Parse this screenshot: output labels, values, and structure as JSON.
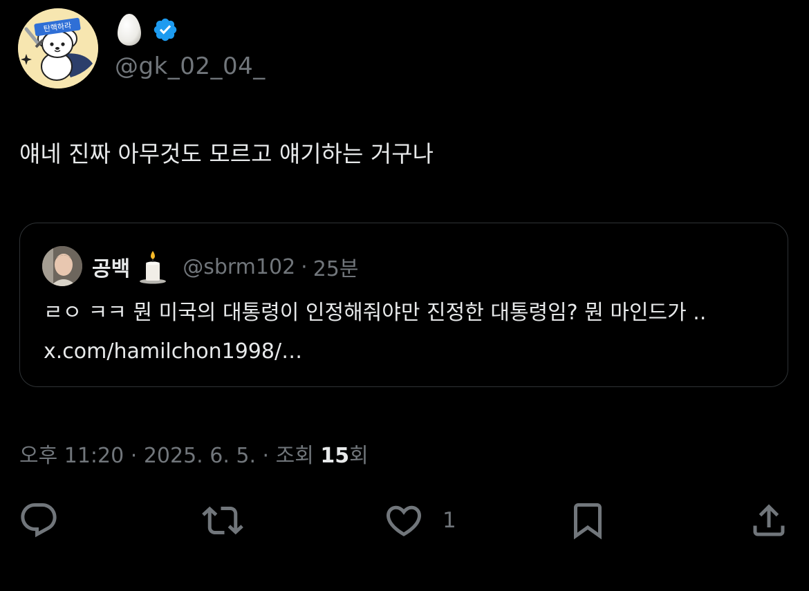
{
  "author": {
    "avatar_badge_text": "탄핵하라",
    "handle": "@gk_02_04_",
    "verified": true,
    "display_name_icon": "egg-emoji"
  },
  "tweet": {
    "text": "얘네 진짜 아무것도 모르고 얘기하는 거구나"
  },
  "quote": {
    "name": "공백",
    "name_icon": "candle-emoji",
    "handle": "@sbrm102",
    "separator": "·",
    "time": "25분",
    "text": "ㄹㅇ ㅋㅋ 뭔 미국의 대통령이 인정해줘야만 진정한 대통령임? 뭔 마인드가 .. x.com/hamilchon1998/…"
  },
  "meta": {
    "time": "오후 11:20",
    "sep1": " · ",
    "date": "2025. 6. 5.",
    "sep2": " · ",
    "views_label": "조회 ",
    "views_count": "15",
    "views_suffix": "회"
  },
  "actions": {
    "reply_icon": "reply-icon",
    "retweet_icon": "retweet-icon",
    "like_icon": "heart-icon",
    "like_count": "1",
    "bookmark_icon": "bookmark-icon",
    "share_icon": "share-icon"
  },
  "colors": {
    "background": "#000000",
    "text": "#e7e9ea",
    "secondary": "#71767b",
    "border": "#2f3336",
    "verified": "#1d9bf0"
  }
}
